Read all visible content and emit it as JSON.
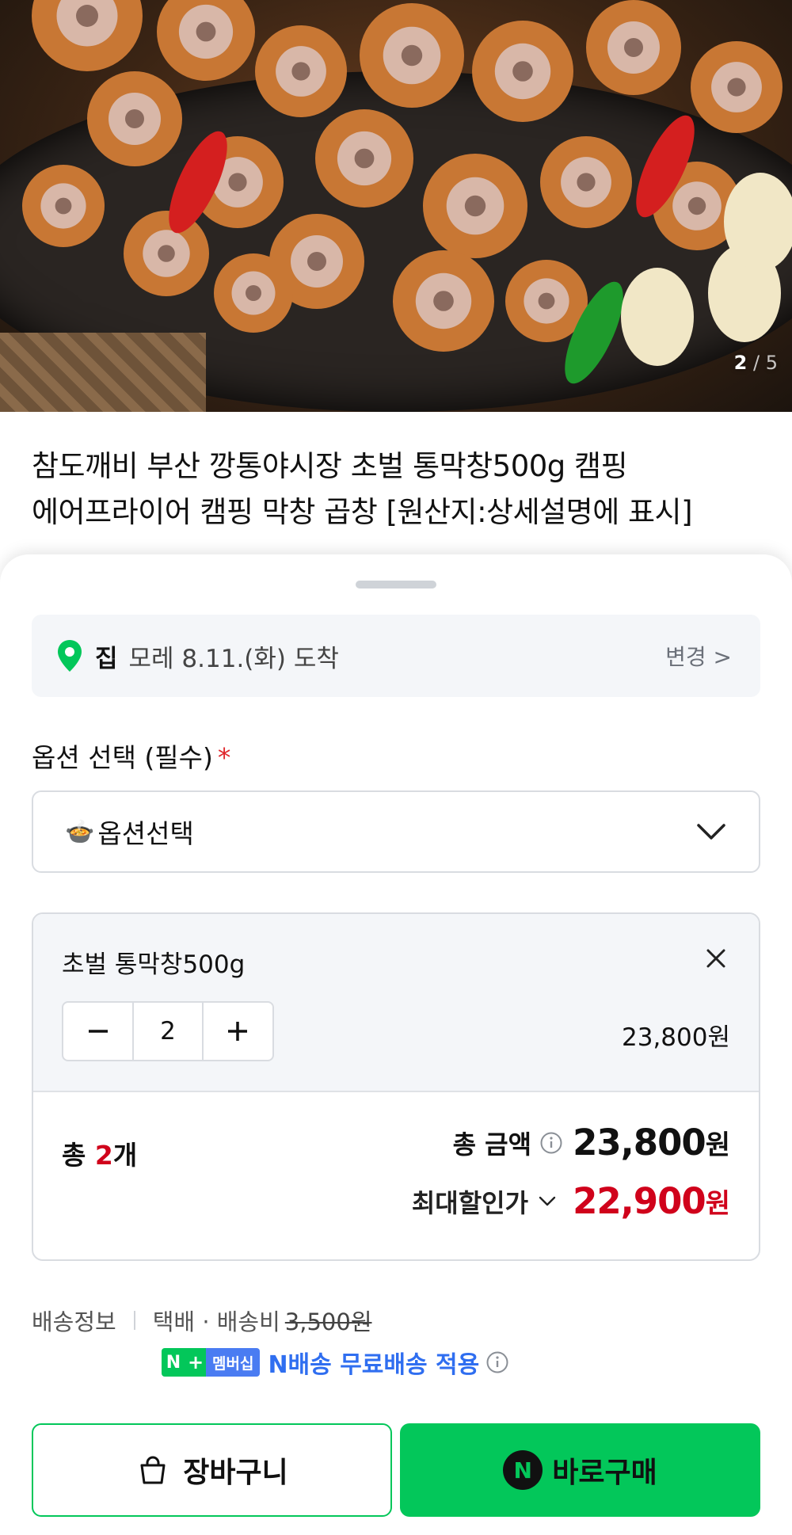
{
  "hero": {
    "image_desc_icon": "grilled-makchang-photo",
    "current_page": "2",
    "separator": "/",
    "total_pages": "5"
  },
  "product": {
    "title_line1": "참도깨비 부산 깡통야시장 초벌 통막창500g 캠핑",
    "title_line2": "에어프라이어 캠핑 막창 곱창 [원산지:상세설명에 표시]"
  },
  "delivery": {
    "pin_icon": "location-pin-icon",
    "place": "집",
    "date": "모레 8.11.(화) 도착",
    "change_label": "변경 >"
  },
  "options": {
    "label": "옵션 선택 (필수)",
    "required_mark": "*",
    "select_icon": "pot",
    "select_value": "옵션선택"
  },
  "selected_item": {
    "name": "초벌 통막창500g",
    "minus": "−",
    "quantity": "2",
    "plus": "+",
    "price": "23,800원"
  },
  "summary": {
    "total_prefix": "총 ",
    "total_count": "2",
    "total_suffix": "개",
    "total_amount_label": "총 금액",
    "total_amount": "23,800",
    "won": "원",
    "max_discount_label": "최대할인가",
    "max_discount_amount": "22,900"
  },
  "shipping": {
    "label": "배송정보",
    "method": "택배 · 배송비",
    "fee": "3,500원",
    "badge_n": "N",
    "badge_plus": "+",
    "badge_membership": "멤버십",
    "member_text": "N배송 무료배송 적용"
  },
  "actions": {
    "cart_label": "장바구니",
    "buy_logo": "N",
    "buy_label": "바로구매"
  },
  "colors": {
    "naver_green": "#03c75a",
    "price_red": "#d0021b",
    "member_blue": "#2f6ef0"
  }
}
